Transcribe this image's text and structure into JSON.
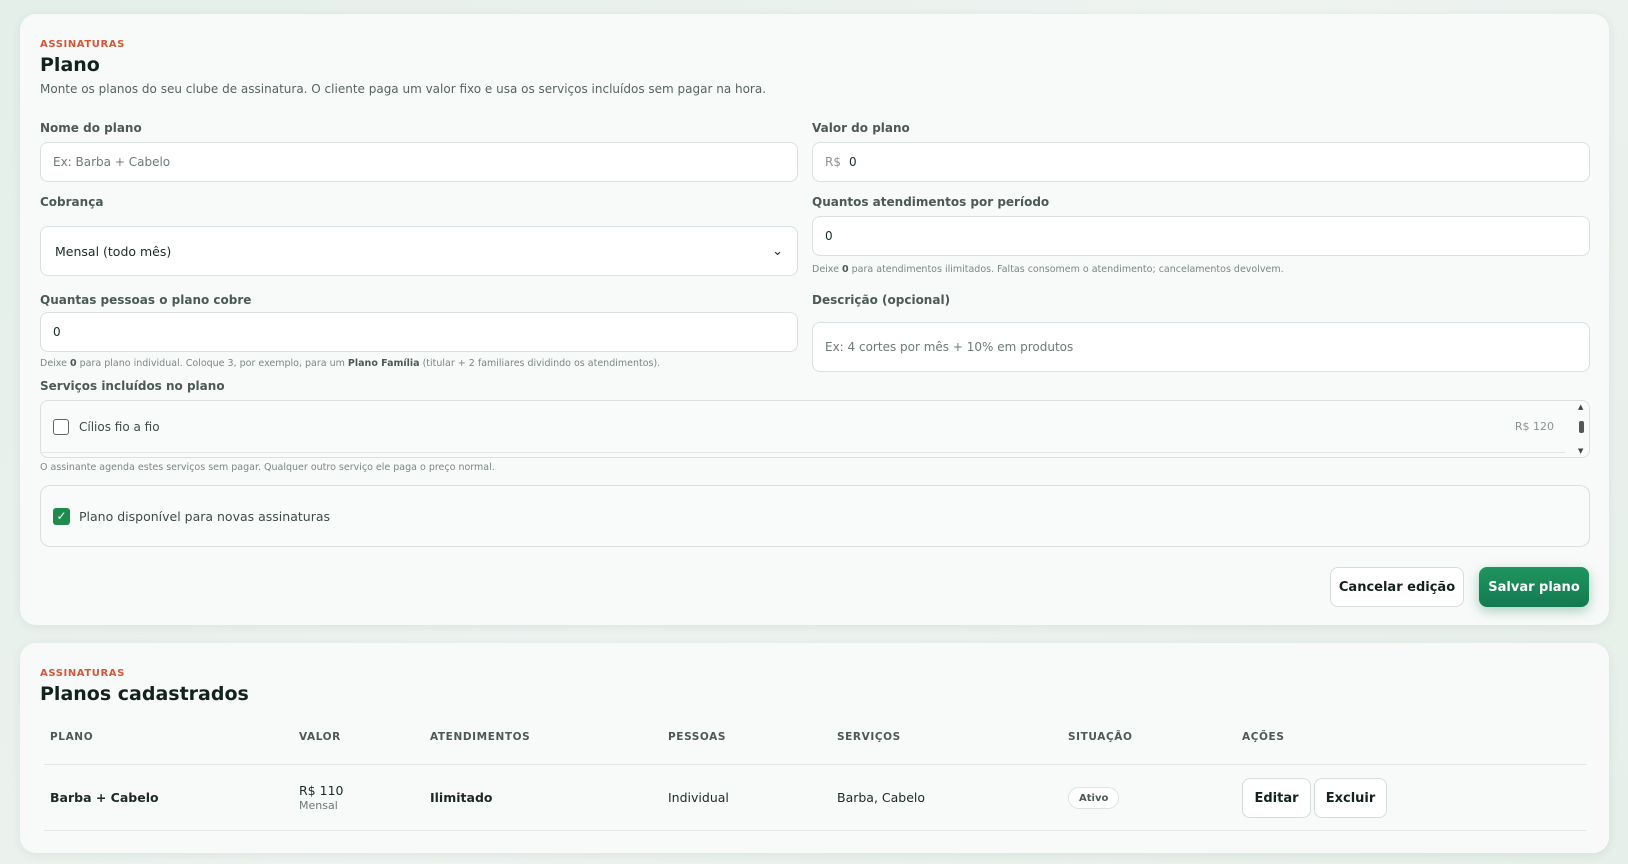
{
  "form": {
    "eyebrow": "ASSINATURAS",
    "title": "Plano",
    "subtitle": "Monte os planos do seu clube de assinatura. O cliente paga um valor fixo e usa os serviços incluídos sem pagar na hora.",
    "plan_name": {
      "label": "Nome do plano",
      "value": "",
      "placeholder": "Ex: Barba + Cabelo"
    },
    "plan_value": {
      "label": "Valor do plano",
      "prefix": "R$",
      "value": "0"
    },
    "billing": {
      "label": "Cobrança",
      "selected": "Mensal (todo mês)"
    },
    "sessions": {
      "label": "Quantos atendimentos por período",
      "value": "0",
      "hint_pre": "Deixe ",
      "hint_bold": "0",
      "hint_post": " para atendimentos ilimitados. Faltas consomem o atendimento; cancelamentos devolvem."
    },
    "people": {
      "label": "Quantas pessoas o plano cobre",
      "value": "0",
      "hint_1": "Deixe ",
      "hint_bold_1": "0",
      "hint_2": " para plano individual. Coloque 3, por exemplo, para um ",
      "hint_bold_2": "Plano Família",
      "hint_3": " (titular + 2 familiares dividindo os atendimentos)."
    },
    "description": {
      "label": "Descrição (opcional)",
      "value": "",
      "placeholder": "Ex: 4 cortes por mês + 10% em produtos"
    },
    "services": {
      "label": "Serviços incluídos no plano",
      "items": [
        {
          "name": "Cílios fio a fio",
          "price": "R$ 120",
          "checked": false
        }
      ],
      "hint": "O assinante agenda estes serviços sem pagar. Qualquer outro serviço ele paga o preço normal."
    },
    "available": {
      "label": "Plano disponível para novas assinaturas",
      "checked": true
    },
    "cancel_label": "Cancelar edição",
    "save_label": "Salvar plano"
  },
  "list": {
    "eyebrow": "ASSINATURAS",
    "title": "Planos cadastrados",
    "headers": [
      "PLANO",
      "VALOR",
      "ATENDIMENTOS",
      "PESSOAS",
      "SERVIÇOS",
      "SITUAÇÃO",
      "AÇÕES"
    ],
    "rows": [
      {
        "plan": "Barba + Cabelo",
        "value": "R$ 110",
        "period": "Mensal",
        "sessions": "Ilimitado",
        "people": "Individual",
        "services": "Barba, Cabelo",
        "status": "Ativo",
        "edit_label": "Editar",
        "delete_label": "Excluir"
      }
    ]
  }
}
